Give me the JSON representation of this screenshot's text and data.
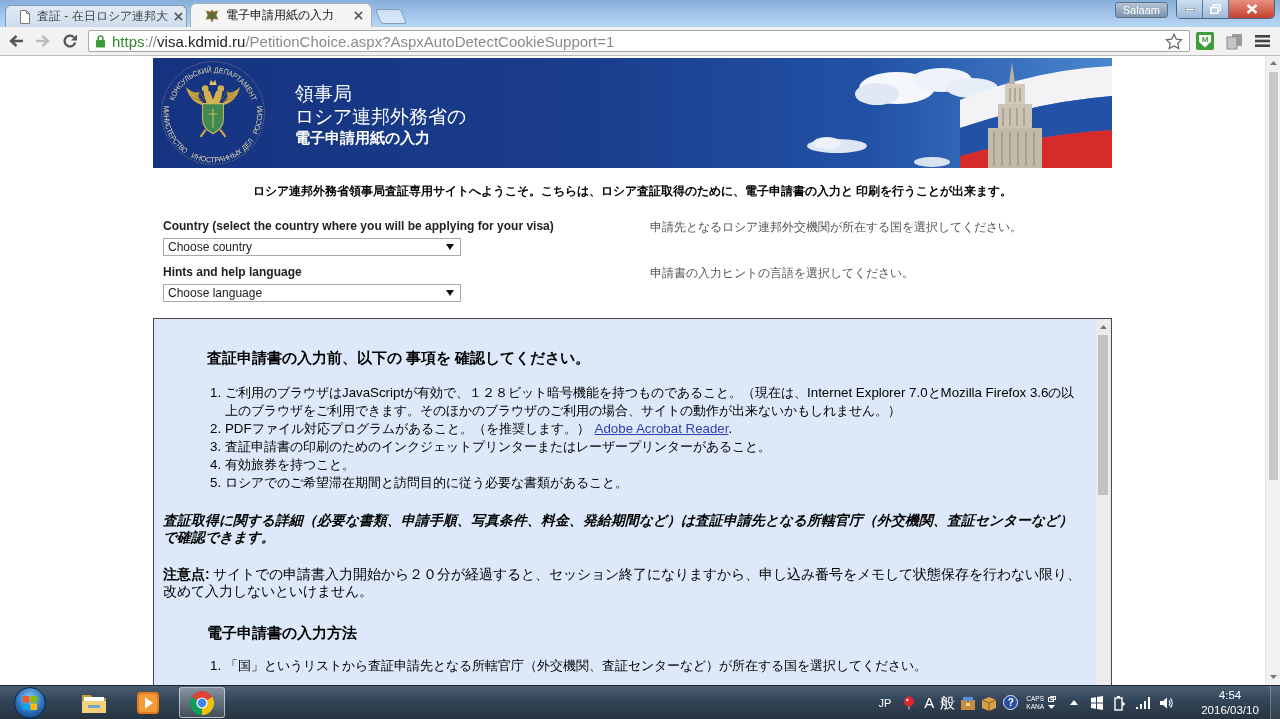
{
  "browser": {
    "tabs": [
      {
        "title": "査証 - 在日ロシア連邦大",
        "kind": "document",
        "selected": false
      },
      {
        "title": "電子申請用紙の入力",
        "kind": "site",
        "selected": true
      }
    ],
    "user": "Salaam",
    "back": {
      "disabled": false
    },
    "forward": {
      "disabled": true
    },
    "url": {
      "scheme": "https",
      "separator": "://",
      "host": "visa.kdmid.ru",
      "path": "/PetitionChoice.aspx?AspxAutoDetectCookieSupport=1"
    },
    "extension": "M"
  },
  "banner": {
    "seal_top": "КОНСУЛЬСКИЙ ДЕПАРТАМЕНТ",
    "seal_bottom": [
      "МИНИСТЕРСТВО",
      "ИНОСТРАННЫХ ДЕЛ",
      "РОССИИ"
    ],
    "title_lines": [
      "領事局",
      "ロシア連邦外務省の",
      "電子申請用紙の入力"
    ]
  },
  "welcome": "ロシア連邦外務省領事局査証専用サイトへようこそ。こちらは、ロシア査証取得のために、電子申請書の入力と 印刷を行うことが出来ます。",
  "fields": [
    {
      "label": "Country (select the country where you will be applying for your visa)",
      "value": "Choose country",
      "hint": "申請先となるロシア連邦外交機関が所在する国を選択してください。"
    },
    {
      "label": "Hints and help language",
      "value": "Choose language",
      "hint": "申請書の入力ヒントの言語を選択してください。"
    }
  ],
  "info": [
    {
      "kind": "heading",
      "text": "査証申請書の入力前、以下の 事項を 確認してください。"
    },
    {
      "kind": "list",
      "items": [
        {
          "number": "1.",
          "text": "ご利用のブラウザはJavaScriptが有効で、１２８ビット暗号機能を持つものであること。（現在は、Internet Explorer 7.0とMozilla Firefox 3.6の以上のブラウザをご利用できます。そのほかのブラウザのご利用の場合、サイトの動作が出来ないかもしれません。）"
        },
        {
          "number": "2.",
          "text": "PDFファイル対応プログラムがあること。（を推奨します。）",
          "link": "Adobe Acrobat Reader",
          "tail": "."
        },
        {
          "number": "3.",
          "text": "査証申請書の印刷のためのインクジェットプリンターまたはレーザープリンターがあること。"
        },
        {
          "number": "4.",
          "text": "有効旅券を持つこと。"
        },
        {
          "number": "5.",
          "text": "ロシアでのご希望滞在期間と訪問目的に従う必要な書類があること。"
        }
      ]
    },
    {
      "kind": "note",
      "text": "査証取得に関する詳細（必要な書類、申請手順、写真条件、料金、発給期間など）は査証申請先となる所轄官庁（外交機関、査証センターなど）で確認できます。"
    },
    {
      "kind": "paragraph",
      "text": "**注意点:** サイトでの申請書入力開始から２０分が経過すると、セッション終了になりますから、申し込み番号をメモして状態保存を行わない限り、改めて入力しないといけません。"
    },
    {
      "kind": "heading",
      "text": "電子申請書の入力方法"
    },
    {
      "kind": "list",
      "items": [
        {
          "number": "1.",
          "text": "「国」というリストから査証申請先となる所轄官庁（外交機関、査証センターなど）が所在する国を選択してください。"
        }
      ]
    }
  ],
  "taskbar": {
    "apps": [
      {
        "kind": "folder",
        "selected": false
      },
      {
        "kind": "player",
        "selected": false
      },
      {
        "kind": "browser",
        "selected": true
      }
    ],
    "tray": {
      "language": "JP",
      "ime_mode": "A",
      "ime_kanji": "般",
      "help": "?",
      "caps": "CAPS",
      "kana": "KANA",
      "time": "4:54",
      "date": "2016/03/10"
    }
  }
}
